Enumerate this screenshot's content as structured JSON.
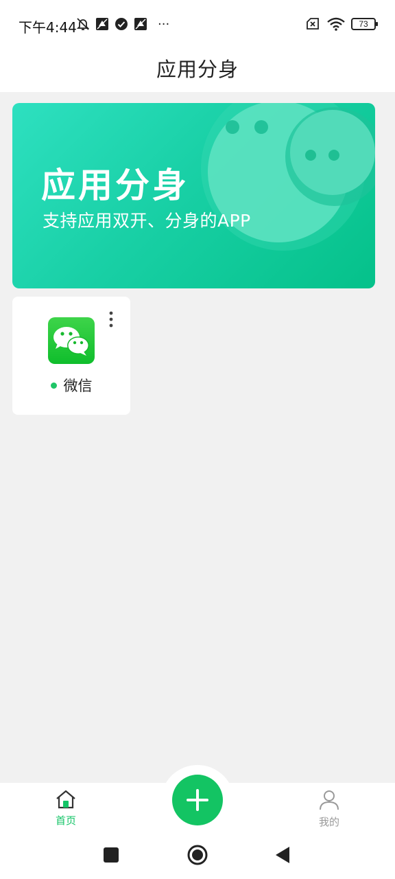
{
  "status_bar": {
    "time": "下午4:44",
    "more": "···",
    "battery": "73"
  },
  "header": {
    "title": "应用分身"
  },
  "banner": {
    "title": "应用分身",
    "subtitle": "支持应用双开、分身的APP"
  },
  "apps": [
    {
      "name": "微信",
      "icon": "wechat-icon",
      "status_color": "#1fc567"
    }
  ],
  "bottom_nav": {
    "items": [
      {
        "label": "首页",
        "icon": "home-icon",
        "active": true
      },
      {
        "label": "我的",
        "icon": "user-icon",
        "active": false
      }
    ],
    "fab_icon": "plus-icon"
  },
  "colors": {
    "accent": "#13c463",
    "inactive": "#9a9a9a",
    "background": "#f1f1f1"
  }
}
